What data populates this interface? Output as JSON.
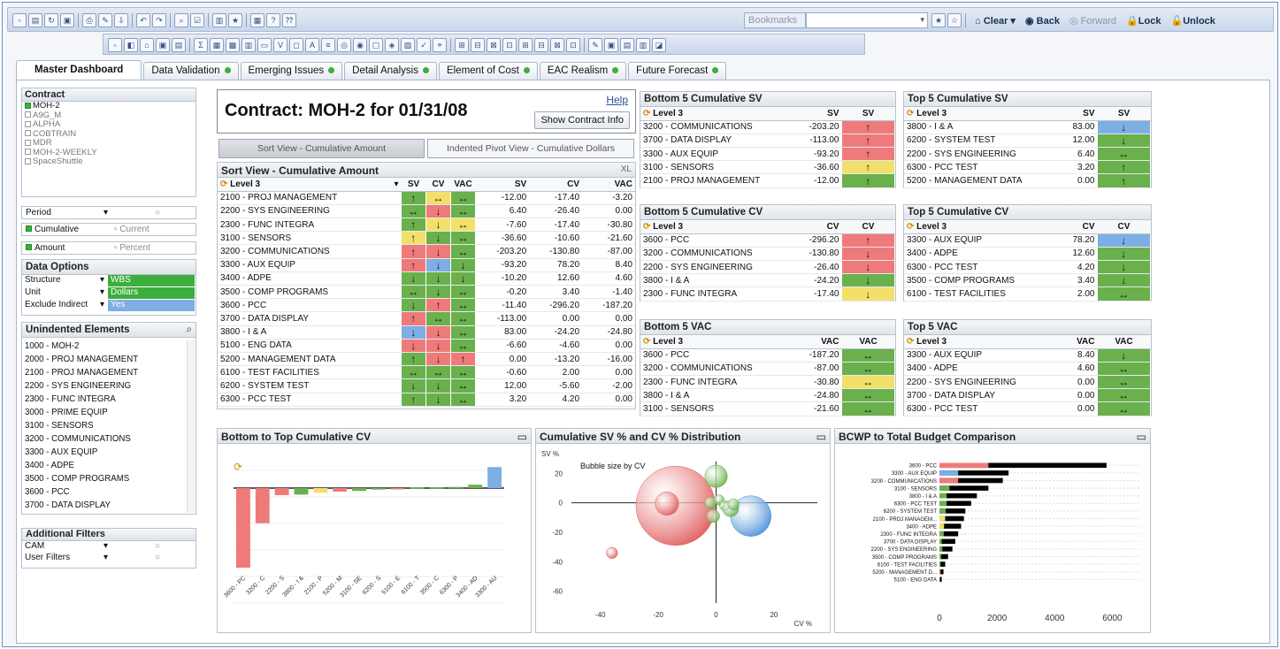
{
  "toolbar": {
    "bookmarks_placeholder": "Bookmarks",
    "clear": "Clear",
    "back": "Back",
    "forward": "Forward",
    "lock": "Lock",
    "unlock": "Unlock"
  },
  "tabs": [
    "Master Dashboard",
    "Data Validation",
    "Emerging Issues",
    "Detail Analysis",
    "Element of Cost",
    "EAC Realism",
    "Future Forecast"
  ],
  "contract_list": {
    "title": "Contract",
    "items": [
      "MOH-2",
      "A9G_M",
      "ALPHA",
      "COBTRAIN",
      "MDR",
      "MOH-2-WEEKLY",
      "SpaceShuttle"
    ]
  },
  "period": {
    "label": "Period",
    "cumulative": "Cumulative",
    "current": "Current",
    "amount": "Amount",
    "percent": "Percent"
  },
  "data_options": {
    "title": "Data Options",
    "rows": [
      {
        "label": "Structure",
        "value": "WBS"
      },
      {
        "label": "Unit",
        "value": "Dollars"
      },
      {
        "label": "Exclude Indirect",
        "value": "Yes"
      }
    ]
  },
  "unindented": {
    "title": "Unindented Elements",
    "items": [
      "1000 - MOH-2",
      "2000 - PROJ MANAGEMENT",
      "2100 - PROJ MANAGEMENT",
      "2200 - SYS ENGINEERING",
      "2300 - FUNC INTEGRA",
      "3000 - PRIME EQUIP",
      "3100 - SENSORS",
      "3200 - COMMUNICATIONS",
      "3300 - AUX EQUIP",
      "3400 - ADPE",
      "3500 - COMP PROGRAMS",
      "3600 - PCC",
      "3700 - DATA DISPLAY"
    ]
  },
  "additional_filters": {
    "title": "Additional Filters",
    "rows": [
      "CAM",
      "User Filters"
    ]
  },
  "contract_header": {
    "title": "Contract: MOH-2 for 01/31/08",
    "help": "Help",
    "show_info": "Show Contract Info",
    "sort_view_btn": "Sort View - Cumulative Amount",
    "pivot_view_btn": "Indented Pivot View - Cumulative Dollars"
  },
  "sort_view": {
    "title": "Sort View - Cumulative Amount",
    "xl": "XL",
    "headers": [
      "Level 3",
      "SV",
      "CV",
      "VAC",
      "SV",
      "CV",
      "VAC"
    ],
    "rows": [
      {
        "name": "2100 - PROJ MANAGEMENT",
        "a": [
          "↑",
          "↔",
          "↔"
        ],
        "c": [
          "g",
          "y",
          "g"
        ],
        "sv": "-12.00",
        "cv": "-17.40",
        "vac": "-3.20"
      },
      {
        "name": "2200 - SYS ENGINEERING",
        "a": [
          "↔",
          "↓",
          "↔"
        ],
        "c": [
          "g",
          "r",
          "g"
        ],
        "sv": "6.40",
        "cv": "-26.40",
        "vac": "0.00"
      },
      {
        "name": "2300 - FUNC INTEGRA",
        "a": [
          "↑",
          "↓",
          "↔"
        ],
        "c": [
          "g",
          "y",
          "y"
        ],
        "sv": "-7.60",
        "cv": "-17.40",
        "vac": "-30.80"
      },
      {
        "name": "3100 - SENSORS",
        "a": [
          "↑",
          "↓",
          "↔"
        ],
        "c": [
          "y",
          "g",
          "g"
        ],
        "sv": "-36.60",
        "cv": "-10.60",
        "vac": "-21.60"
      },
      {
        "name": "3200 - COMMUNICATIONS",
        "a": [
          "↑",
          "↓",
          "↔"
        ],
        "c": [
          "r",
          "r",
          "g"
        ],
        "sv": "-203.20",
        "cv": "-130.80",
        "vac": "-87.00"
      },
      {
        "name": "3300 - AUX EQUIP",
        "a": [
          "↑",
          "↓",
          "↓"
        ],
        "c": [
          "r",
          "b",
          "g"
        ],
        "sv": "-93.20",
        "cv": "78.20",
        "vac": "8.40"
      },
      {
        "name": "3400 - ADPE",
        "a": [
          "↓",
          "↓",
          "↓"
        ],
        "c": [
          "g",
          "g",
          "g"
        ],
        "sv": "-10.20",
        "cv": "12.60",
        "vac": "4.60"
      },
      {
        "name": "3500 - COMP PROGRAMS",
        "a": [
          "↔",
          "↓",
          "↔"
        ],
        "c": [
          "g",
          "g",
          "g"
        ],
        "sv": "-0.20",
        "cv": "3.40",
        "vac": "-1.40"
      },
      {
        "name": "3600 - PCC",
        "a": [
          "↓",
          "↑",
          "↔"
        ],
        "c": [
          "g",
          "r",
          "g"
        ],
        "sv": "-11.40",
        "cv": "-296.20",
        "vac": "-187.20"
      },
      {
        "name": "3700 - DATA DISPLAY",
        "a": [
          "↑",
          "↔",
          "↔"
        ],
        "c": [
          "r",
          "g",
          "g"
        ],
        "sv": "-113.00",
        "cv": "0.00",
        "vac": "0.00"
      },
      {
        "name": "3800 - I & A",
        "a": [
          "↓",
          "↓",
          "↔"
        ],
        "c": [
          "b",
          "r",
          "g"
        ],
        "sv": "83.00",
        "cv": "-24.20",
        "vac": "-24.80"
      },
      {
        "name": "5100 - ENG DATA",
        "a": [
          "↓",
          "↓",
          "↔"
        ],
        "c": [
          "r",
          "r",
          "g"
        ],
        "sv": "-6.60",
        "cv": "-4.60",
        "vac": "0.00"
      },
      {
        "name": "5200 - MANAGEMENT DATA",
        "a": [
          "↑",
          "↓",
          "↑"
        ],
        "c": [
          "g",
          "r",
          "r"
        ],
        "sv": "0.00",
        "cv": "-13.20",
        "vac": "-16.00"
      },
      {
        "name": "6100 - TEST FACILITIES",
        "a": [
          "↔",
          "↔",
          "↔"
        ],
        "c": [
          "g",
          "g",
          "g"
        ],
        "sv": "-0.60",
        "cv": "2.00",
        "vac": "0.00"
      },
      {
        "name": "6200 - SYSTEM TEST",
        "a": [
          "↓",
          "↓",
          "↔"
        ],
        "c": [
          "g",
          "g",
          "g"
        ],
        "sv": "12.00",
        "cv": "-5.60",
        "vac": "-2.00"
      },
      {
        "name": "6300 - PCC TEST",
        "a": [
          "↑",
          "↓",
          "↔"
        ],
        "c": [
          "g",
          "g",
          "g"
        ],
        "sv": "3.20",
        "cv": "4.20",
        "vac": "0.00"
      }
    ]
  },
  "small_tables": [
    {
      "id": "b5sv",
      "title": "Bottom 5 Cumulative SV",
      "h1": "Level 3",
      "h2": "SV",
      "h3": "SV",
      "rows": [
        [
          "3200 - COMMUNICATIONS",
          "-203.20",
          "↑",
          "r"
        ],
        [
          "3700 - DATA DISPLAY",
          "-113.00",
          "↑",
          "r"
        ],
        [
          "3300 - AUX EQUIP",
          "-93.20",
          "↑",
          "r"
        ],
        [
          "3100 - SENSORS",
          "-36.60",
          "↑",
          "y"
        ],
        [
          "2100 - PROJ MANAGEMENT",
          "-12.00",
          "↑",
          "g"
        ]
      ]
    },
    {
      "id": "t5sv",
      "title": "Top 5 Cumulative SV",
      "h1": "Level 3",
      "h2": "SV",
      "h3": "SV",
      "rows": [
        [
          "3800 - I & A",
          "83.00",
          "↓",
          "b"
        ],
        [
          "6200 - SYSTEM TEST",
          "12.00",
          "↓",
          "g"
        ],
        [
          "2200 - SYS ENGINEERING",
          "6.40",
          "↔",
          "g"
        ],
        [
          "6300 - PCC TEST",
          "3.20",
          "↑",
          "g"
        ],
        [
          "5200 - MANAGEMENT DATA",
          "0.00",
          "↑",
          "g"
        ]
      ]
    },
    {
      "id": "b5cv",
      "title": "Bottom 5 Cumulative CV",
      "h1": "Level 3",
      "h2": "CV",
      "h3": "CV",
      "rows": [
        [
          "3600 - PCC",
          "-296.20",
          "↑",
          "r"
        ],
        [
          "3200 - COMMUNICATIONS",
          "-130.80",
          "↓",
          "r"
        ],
        [
          "2200 - SYS ENGINEERING",
          "-26.40",
          "↓",
          "r"
        ],
        [
          "3800 - I & A",
          "-24.20",
          "↓",
          "g"
        ],
        [
          "2300 - FUNC INTEGRA",
          "-17.40",
          "↓",
          "y"
        ]
      ]
    },
    {
      "id": "t5cv",
      "title": "Top 5 Cumulative CV",
      "h1": "Level 3",
      "h2": "CV",
      "h3": "CV",
      "rows": [
        [
          "3300 - AUX EQUIP",
          "78.20",
          "↓",
          "b"
        ],
        [
          "3400 - ADPE",
          "12.60",
          "↓",
          "g"
        ],
        [
          "6300 - PCC TEST",
          "4.20",
          "↓",
          "g"
        ],
        [
          "3500 - COMP PROGRAMS",
          "3.40",
          "↓",
          "g"
        ],
        [
          "6100 - TEST FACILITIES",
          "2.00",
          "↔",
          "g"
        ]
      ]
    },
    {
      "id": "b5vac",
      "title": "Bottom 5 VAC",
      "h1": "Level 3",
      "h2": "VAC",
      "h3": "VAC",
      "rows": [
        [
          "3600 - PCC",
          "-187.20",
          "↔",
          "g"
        ],
        [
          "3200 - COMMUNICATIONS",
          "-87.00",
          "↔",
          "g"
        ],
        [
          "2300 - FUNC INTEGRA",
          "-30.80",
          "↔",
          "y"
        ],
        [
          "3800 - I & A",
          "-24.80",
          "↔",
          "g"
        ],
        [
          "3100 - SENSORS",
          "-21.60",
          "↔",
          "g"
        ]
      ]
    },
    {
      "id": "t5vac",
      "title": "Top 5 VAC",
      "h1": "Level 3",
      "h2": "VAC",
      "h3": "VAC",
      "rows": [
        [
          "3300 - AUX EQUIP",
          "8.40",
          "↓",
          "g"
        ],
        [
          "3400 - ADPE",
          "4.60",
          "↔",
          "g"
        ],
        [
          "2200 - SYS ENGINEERING",
          "0.00",
          "↔",
          "g"
        ],
        [
          "3700 - DATA DISPLAY",
          "0.00",
          "↔",
          "g"
        ],
        [
          "6300 - PCC TEST",
          "0.00",
          "↔",
          "g"
        ]
      ]
    }
  ],
  "chart_data": [
    {
      "type": "bar",
      "title": "Bottom to Top Cumulative CV",
      "categories": [
        "3600 - PCC",
        "3200 - COMMUNICATIONS",
        "2200 - SYS ENGINEERING",
        "3800 - I & A",
        "2100 - PROJ MANAGEMENT",
        "5200 - MANAGEMENT DATA",
        "3100 - SENSORS",
        "6200 - SYSTEM TEST",
        "5100 - ENG DATA",
        "6100 - TEST FACILITIES",
        "3500 - COMP PROGRAMS",
        "6300 - PCC TEST",
        "3400 - ADPE",
        "3300 - AUX EQUIP"
      ],
      "tick_labels": [
        "3600 - PC",
        "3200 - C",
        "2200 - S",
        "3800 - I &",
        "2100 - P",
        "5200 - M",
        "3100 - SE",
        "6200 - S",
        "5100 - E",
        "6100 - T",
        "3500 - C",
        "6300 - P",
        "3400 - AD",
        "3300 - AU"
      ],
      "values": [
        -296.2,
        -130.8,
        -26.4,
        -24.2,
        -17.4,
        -13.2,
        -10.6,
        -5.6,
        -4.6,
        2.0,
        3.4,
        4.2,
        12.6,
        78.2
      ],
      "colors": [
        "#ef7a7a",
        "#ef7a7a",
        "#ef7a7a",
        "#6ab04c",
        "#f2e06a",
        "#ef7a7a",
        "#6ab04c",
        "#6ab04c",
        "#ef7a7a",
        "#6ab04c",
        "#6ab04c",
        "#6ab04c",
        "#6ab04c",
        "#7daee4"
      ]
    },
    {
      "type": "scatter",
      "title": "Cumulative SV % and CV % Distribution",
      "subtitle": "Bubble size by CV",
      "xlabel": "CV %",
      "ylabel": "SV %",
      "xlim": [
        -50,
        35
      ],
      "ylim": [
        -68,
        28
      ],
      "xticks": [
        -40,
        -20,
        0,
        20
      ],
      "yticks": [
        20,
        0,
        -20,
        -40,
        -60
      ],
      "points": [
        {
          "x": -14,
          "y": -2,
          "size": 296.2,
          "color": "#e05a5a"
        },
        {
          "x": -17,
          "y": -0.5,
          "size": 26,
          "color": "#e05a5a"
        },
        {
          "x": -36,
          "y": -34,
          "size": 6,
          "color": "#e05a5a"
        },
        {
          "x": 0,
          "y": 18,
          "size": 24,
          "color": "#6ab04c"
        },
        {
          "x": 12,
          "y": -9,
          "size": 78,
          "color": "#4a90d9"
        },
        {
          "x": -2,
          "y": 0,
          "size": 6,
          "color": "#6ab04c"
        },
        {
          "x": 1,
          "y": 2,
          "size": 5,
          "color": "#6ab04c"
        },
        {
          "x": 3,
          "y": -2,
          "size": 5,
          "color": "#6ab04c"
        },
        {
          "x": 5,
          "y": -4,
          "size": 12,
          "color": "#6ab04c"
        },
        {
          "x": -1,
          "y": -9,
          "size": 8,
          "color": "#6ab04c"
        },
        {
          "x": 6,
          "y": -1,
          "size": 6,
          "color": "#6ab04c"
        }
      ]
    },
    {
      "type": "bar",
      "orientation": "horizontal",
      "title": "BCWP to Total Budget Comparison",
      "xticks": [
        0,
        2000,
        4000,
        6000
      ],
      "xlim": [
        0,
        7000
      ],
      "categories": [
        "3600 - PCC",
        "3300 - AUX EQUIP",
        "3200 - COMMUNICATIONS",
        "3100 - SENSORS",
        "3800 - I & A",
        "6300 - PCC TEST",
        "6200 - SYSTEM TEST",
        "2100 - PROJ MANAGEM...",
        "3400 - ADPE",
        "2300 - FUNC INTEGRA",
        "3700 - DATA DISPLAY",
        "2200 - SYS ENGINEERING",
        "3500 - COMP PROGRAMS",
        "6100 - TEST FACILITIES",
        "5200 - MANAGEMENT D...",
        "5100 - ENG DATA"
      ],
      "bcwp": [
        1700,
        650,
        650,
        350,
        250,
        250,
        220,
        200,
        160,
        150,
        80,
        100,
        60,
        40,
        40,
        20
      ],
      "budget": [
        5800,
        2400,
        2200,
        1700,
        1300,
        1100,
        900,
        850,
        750,
        650,
        550,
        450,
        300,
        200,
        140,
        80
      ],
      "bcwp_colors": [
        "#ef7a7a",
        "#7daee4",
        "#ef7a7a",
        "#6ab04c",
        "#6ab04c",
        "#6ab04c",
        "#6ab04c",
        "#f2e06a",
        "#f2e06a",
        "#6ab04c",
        "#6ab04c",
        "#6ab04c",
        "#6ab04c",
        "#6ab04c",
        "#ef7a7a",
        "#6ab04c"
      ],
      "budget_color": "#000000"
    }
  ]
}
